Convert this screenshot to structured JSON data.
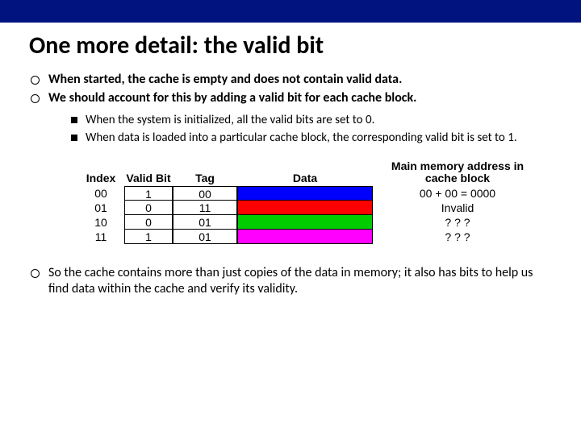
{
  "title": "One more detail: the valid bit",
  "bullets": [
    "When started, the cache is empty and does not contain valid data.",
    "We should account for this by adding a valid bit for each cache block."
  ],
  "subbullets": [
    "When the system is initialized, all the valid bits are set to 0.",
    "When data is loaded into a particular cache block, the corresponding valid bit is set to 1."
  ],
  "table": {
    "headers": {
      "index": "Index",
      "valid": "Valid Bit",
      "tag": "Tag",
      "data": "Data",
      "mem": "Main memory address in cache block"
    },
    "rows": [
      {
        "index": "00",
        "valid": "1",
        "tag": "00",
        "mem": "00 + 00 = 0000"
      },
      {
        "index": "01",
        "valid": "0",
        "tag": "11",
        "mem": "Invalid"
      },
      {
        "index": "10",
        "valid": "0",
        "tag": "01",
        "mem": "? ? ?"
      },
      {
        "index": "11",
        "valid": "1",
        "tag": "01",
        "mem": "? ? ?"
      }
    ],
    "colors": [
      "#0000ff",
      "#ff0000",
      "#00cc00",
      "#ff00ff"
    ]
  },
  "closing": "So the cache contains more than just copies of the data in memory; it also has bits to help us find data within the cache and verify its validity."
}
